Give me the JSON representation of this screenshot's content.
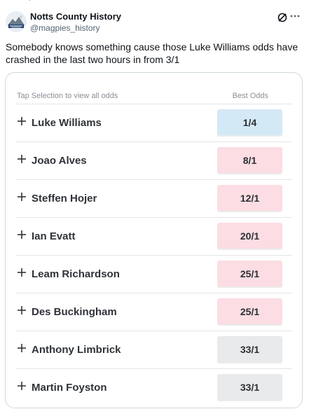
{
  "top_fragment": "• ---",
  "account": {
    "name": "Notts County History",
    "handle": "@magpies_history"
  },
  "post": {
    "text": "Somebody knows something cause those Luke Williams odds have crashed in the last two hours in from 3/1"
  },
  "odds_table": {
    "tap_label": "Tap Selection to view all odds",
    "best_odds_label": "Best Odds",
    "rows": [
      {
        "name": "Luke Williams",
        "odds": "1/4"
      },
      {
        "name": "Joao Alves",
        "odds": "8/1"
      },
      {
        "name": "Steffen Hojer",
        "odds": "12/1"
      },
      {
        "name": "Ian Evatt",
        "odds": "20/1"
      },
      {
        "name": "Leam Richardson",
        "odds": "25/1"
      },
      {
        "name": "Des Buckingham",
        "odds": "25/1"
      },
      {
        "name": "Anthony Limbrick",
        "odds": "33/1"
      },
      {
        "name": "Martin Foyston",
        "odds": "33/1"
      }
    ]
  },
  "colors": {
    "odds_shortened": "#d4e9f6",
    "odds_drifting": "#fbdde3",
    "odds_neutral": "#e8eaec",
    "text_primary": "#0f1419",
    "text_secondary": "#536471",
    "border": "#cfd9de"
  },
  "icons": {
    "avatar": "club-crest",
    "grok": "grok-icon",
    "more": "more-icon",
    "expand": "plus-icon"
  }
}
